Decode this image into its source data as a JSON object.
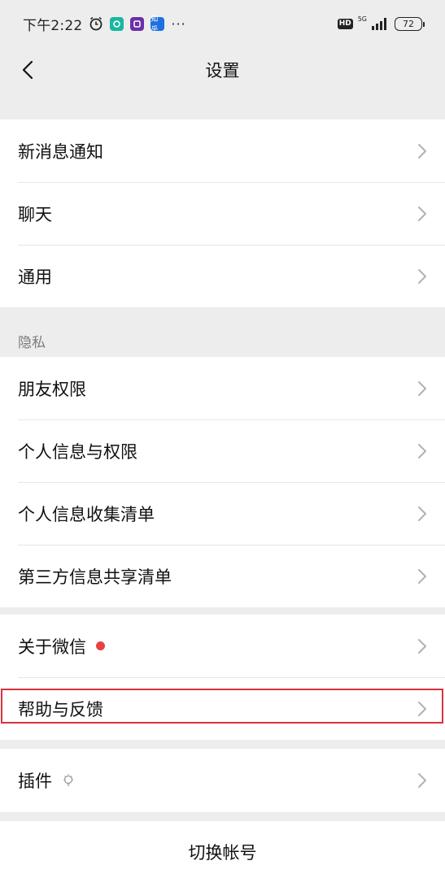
{
  "status_bar": {
    "time": "下午2:22",
    "alarm_icon": "alarm-clock-icon",
    "app_icons": [
      "app-icon-green",
      "app-icon-purple",
      "zhihu-app-icon"
    ],
    "zhihu_label": "知乎",
    "more": "···",
    "hd": "HD",
    "network": "5G",
    "battery": "72"
  },
  "nav": {
    "title": "设置",
    "back_icon": "chevron-left-icon"
  },
  "groups": {
    "g1": [
      "新消息通知",
      "聊天",
      "通用"
    ],
    "privacy_label": "隐私",
    "g2": [
      "朋友权限",
      "个人信息与权限",
      "个人信息收集清单",
      "第三方信息共享清单"
    ],
    "g3": [
      "关于微信",
      "帮助与反馈"
    ],
    "g4": [
      "插件"
    ]
  },
  "switch_account": "切换帐号",
  "colors": {
    "background": "#ededed",
    "red_dot": "#e64340",
    "highlight_border": "#d6343c"
  }
}
